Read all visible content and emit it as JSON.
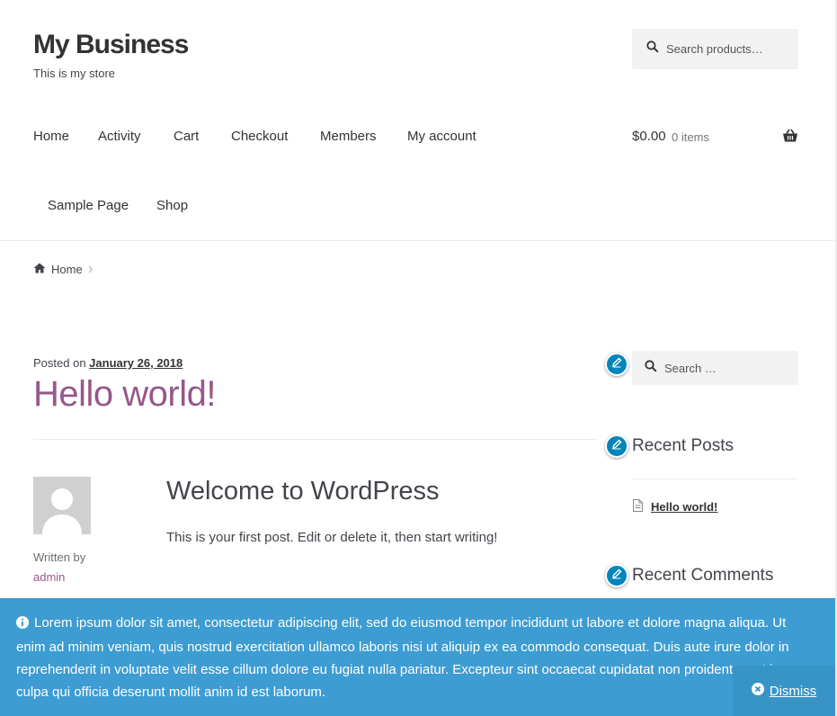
{
  "header": {
    "site_title": "My Business",
    "site_description": "This is my store",
    "search_placeholder": "Search products…"
  },
  "nav": {
    "items": [
      {
        "label": "Home"
      },
      {
        "label": "Activity"
      },
      {
        "label": "Cart"
      },
      {
        "label": "Checkout"
      },
      {
        "label": "Members"
      },
      {
        "label": "My account"
      },
      {
        "label": "Sample Page"
      },
      {
        "label": "Shop"
      }
    ],
    "cart_amount": "$0.00",
    "cart_count": "0 items"
  },
  "breadcrumb": {
    "home": "Home"
  },
  "post": {
    "posted_on_label": "Posted on",
    "date": "January 26, 2018",
    "title": "Hello world!",
    "written_by_label": "Written by",
    "author": "admin",
    "heading": "Welcome to WordPress",
    "text": "This is your first post. Edit or delete it, then start writing!"
  },
  "sidebar": {
    "search_placeholder": "Search …",
    "recent_posts_title": "Recent Posts",
    "recent_posts": [
      "Hello world!"
    ],
    "recent_comments_title": "Recent Comments"
  },
  "store_notice": {
    "text": "Lorem ipsum dolor sit amet, consectetur adipiscing elit, sed do eiusmod tempor incididunt ut labore et dolore magna aliqua. Ut enim ad minim veniam, quis nostrud exercitation ullamco laboris nisi ut aliquip ex ea commodo consequat. Duis aute irure dolor in reprehenderit in voluptate velit esse cillum dolore eu fugiat nulla pariatur. Excepteur sint occaecat cupidatat non proident, sunt in culpa qui officia deserunt mollit anim id est laborum.",
    "dismiss_label": "Dismiss"
  },
  "colors": {
    "accent": "#96588a",
    "notice_bg": "#3d9cd2",
    "edit_bubble": "#0085ba"
  }
}
